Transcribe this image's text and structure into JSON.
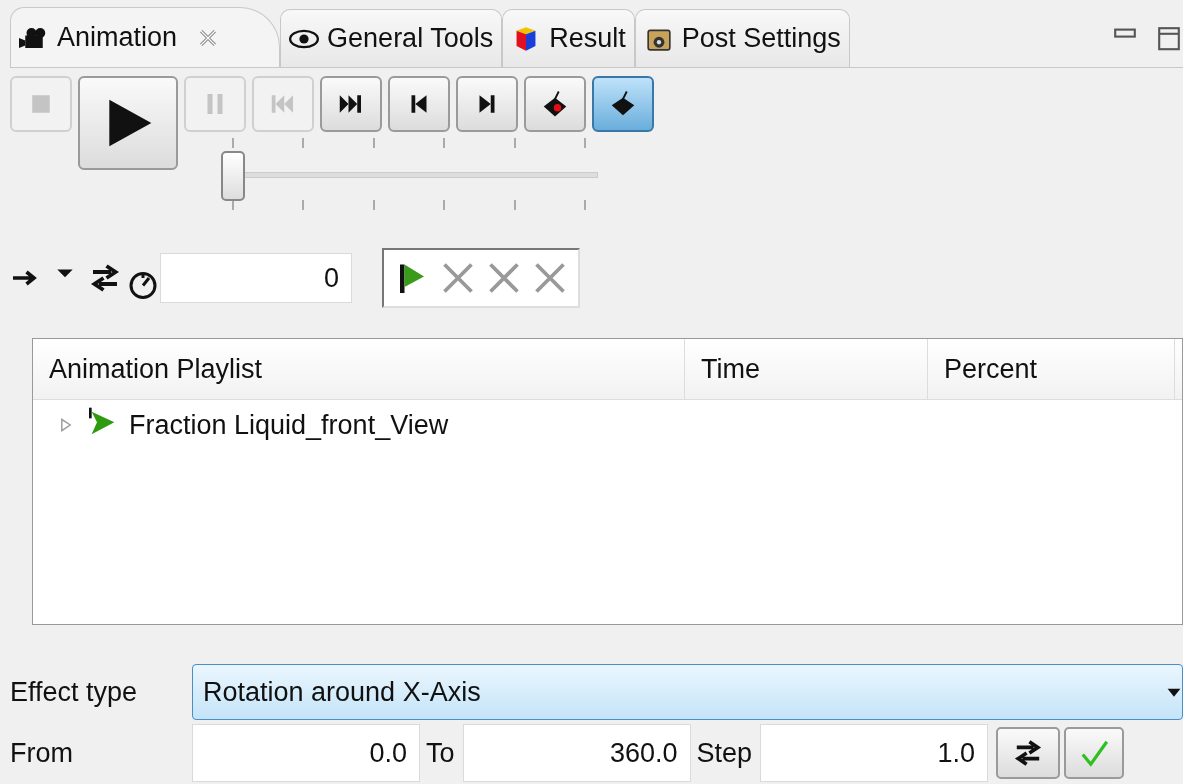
{
  "tabs": [
    {
      "label": "Animation",
      "kind": "camera",
      "selected": true,
      "closable": true
    },
    {
      "label": "General Tools",
      "kind": "eye",
      "selected": false,
      "closable": false
    },
    {
      "label": "Result",
      "kind": "cube",
      "selected": false,
      "closable": false
    },
    {
      "label": "Post Settings",
      "kind": "projector",
      "selected": false,
      "closable": false
    }
  ],
  "toolbar": [
    {
      "kind": "stop",
      "disabled": true,
      "selected": false
    },
    {
      "kind": "play",
      "disabled": false,
      "selected": false
    },
    {
      "kind": "pause",
      "disabled": true,
      "selected": false
    },
    {
      "kind": "first",
      "disabled": true,
      "selected": false
    },
    {
      "kind": "last",
      "disabled": false,
      "selected": false
    },
    {
      "kind": "prev",
      "disabled": false,
      "selected": false
    },
    {
      "kind": "next",
      "disabled": false,
      "selected": false
    },
    {
      "kind": "record",
      "disabled": false,
      "selected": false
    },
    {
      "kind": "ink",
      "disabled": false,
      "selected": true
    }
  ],
  "slider": {
    "level": 0
  },
  "frame_field": {
    "value": "0"
  },
  "keyframes": [
    {
      "kind": "flag"
    },
    {
      "kind": "cross"
    },
    {
      "kind": "cross"
    },
    {
      "kind": "cross"
    }
  ],
  "playlist": {
    "columns": [
      "Animation Playlist",
      "Time",
      "Percent"
    ],
    "rows": [
      {
        "name": "Fraction Liquid_front_View",
        "expanded": false
      }
    ]
  },
  "effect": {
    "label": "Effect type",
    "value": "Rotation around X-Axis"
  },
  "range": [
    {
      "label": "From",
      "value": "0.0"
    },
    {
      "label": "To",
      "value": "360.0"
    },
    {
      "label": "Step",
      "value": "1.0"
    }
  ]
}
